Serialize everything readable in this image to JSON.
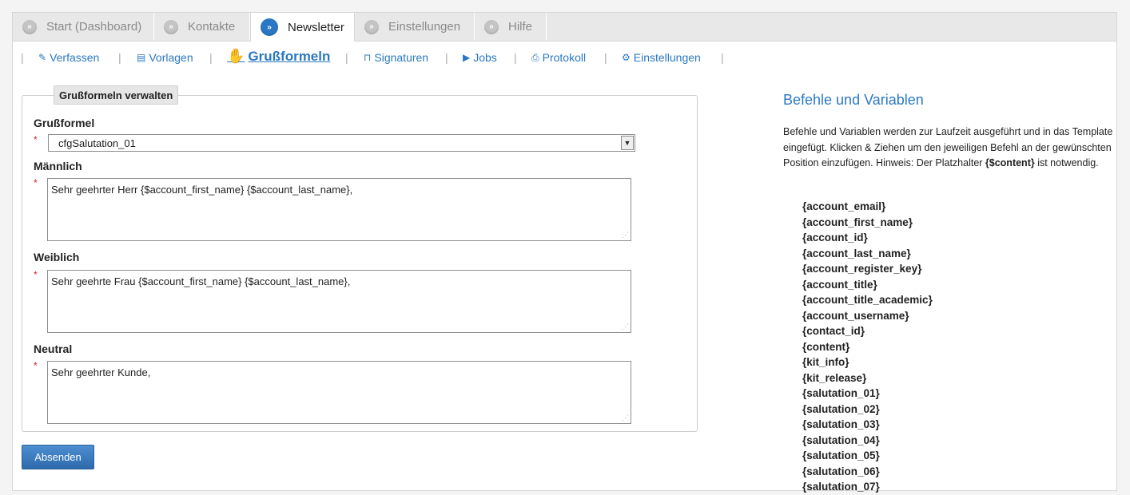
{
  "tabs": [
    {
      "label": "Start (Dashboard)",
      "active": false
    },
    {
      "label": "Kontakte",
      "active": false
    },
    {
      "label": "Newsletter",
      "active": true
    },
    {
      "label": "Einstellungen",
      "active": false
    },
    {
      "label": "Hilfe",
      "active": false
    }
  ],
  "tab_bullet": "»",
  "subnav": {
    "items": [
      {
        "label": "Verfassen",
        "icon": "edit-icon",
        "glyph": "✎"
      },
      {
        "label": "Vorlagen",
        "icon": "template-icon",
        "glyph": "▤"
      },
      {
        "label": "Grußformeln",
        "icon": "hand-icon",
        "glyph": "✋",
        "active": true
      },
      {
        "label": "Signaturen",
        "icon": "bookmark-icon",
        "glyph": "⊓"
      },
      {
        "label": "Jobs",
        "icon": "play-icon",
        "glyph": "▶"
      },
      {
        "label": "Protokoll",
        "icon": "print-icon",
        "glyph": "⎙"
      },
      {
        "label": "Einstellungen",
        "icon": "cogs-icon",
        "glyph": "⚙"
      }
    ],
    "separator": "|"
  },
  "form": {
    "legend": "Grußformeln verwalten",
    "required_marker": "*",
    "salutation_label": "Grußformel",
    "salutation_value": "cfgSalutation_01",
    "male_label": "Männlich",
    "male_value": "Sehr geehrter Herr {$account_first_name} {$account_last_name},",
    "female_label": "Weiblich",
    "female_value": "Sehr geehrte Frau {$account_first_name} {$account_last_name},",
    "neutral_label": "Neutral",
    "neutral_value": "Sehr geehrter Kunde,",
    "submit_label": "Absenden"
  },
  "panel": {
    "title": "Befehle und Variablen",
    "description_pre": "Befehle und Variablen werden zur Laufzeit ausgeführt und in das Template eingefügt. Klicken & Ziehen um den jeweiligen Befehl an der gewünschten Position einzufügen. Hinweis: Der Platzhalter ",
    "description_strong": "{$content}",
    "description_post": " ist notwendig.",
    "variables": [
      "{account_email}",
      "{account_first_name}",
      "{account_id}",
      "{account_last_name}",
      "{account_register_key}",
      "{account_title}",
      "{account_title_academic}",
      "{account_username}",
      "{contact_id}",
      "{content}",
      "{kit_info}",
      "{kit_release}",
      "{salutation_01}",
      "{salutation_02}",
      "{salutation_03}",
      "{salutation_04}",
      "{salutation_05}",
      "{salutation_06}",
      "{salutation_07}"
    ]
  },
  "colors": {
    "accent": "#2a78c4",
    "required": "#cc2222",
    "button": "#3b7fc4"
  }
}
